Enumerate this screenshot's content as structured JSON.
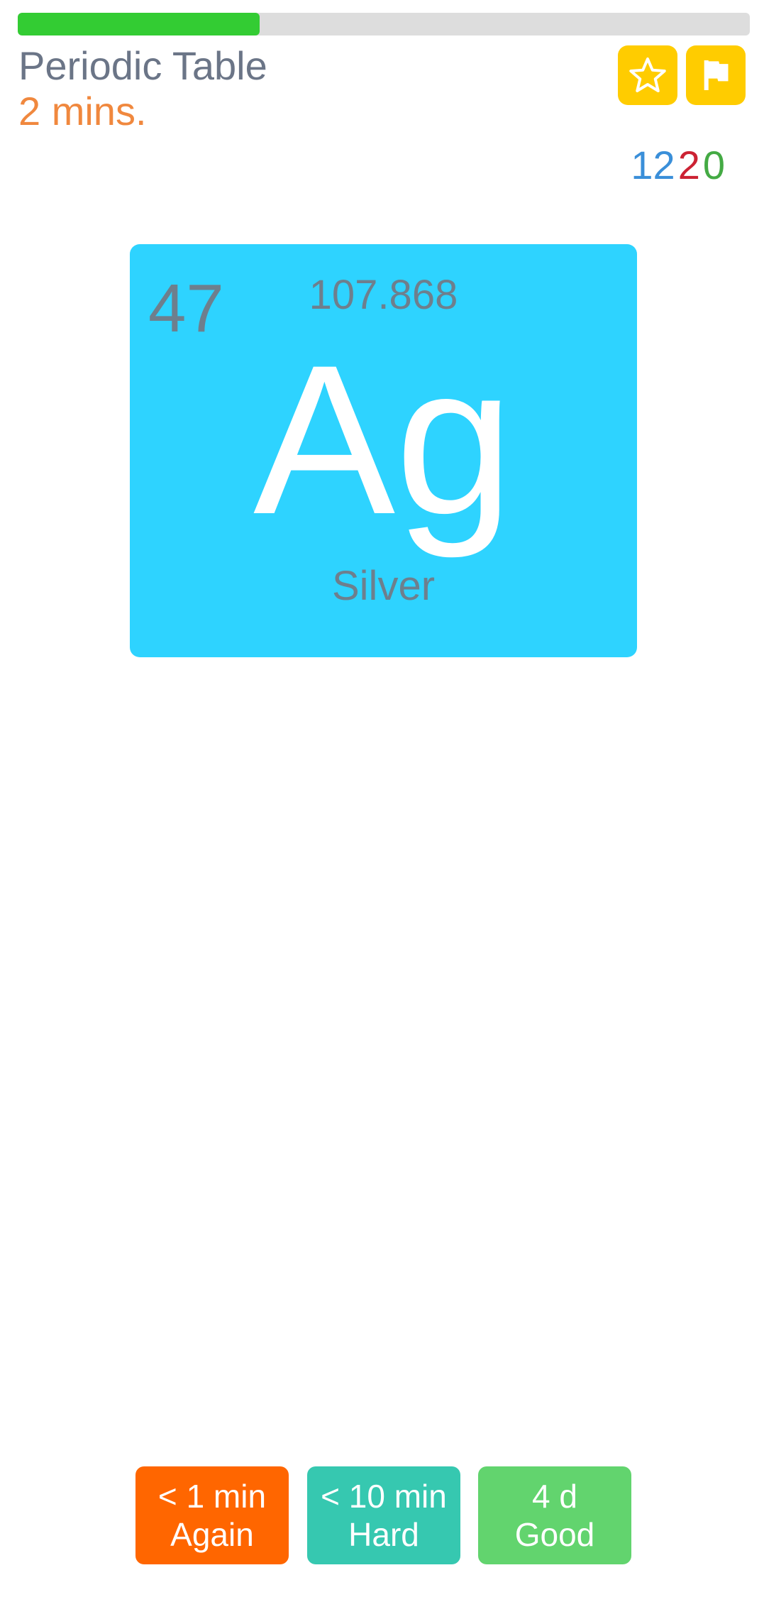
{
  "progress": {
    "fraction": 0.33,
    "fill_color": "#33cc33",
    "track_color": "#dddddd"
  },
  "header": {
    "title": "Periodic Table",
    "time": "2 mins.",
    "star_button_icon": "star-outline-icon",
    "flag_button_icon": "flag-icon"
  },
  "counts": {
    "new": "12",
    "learning": "2",
    "review": "0",
    "colors": {
      "new": "#3a8fd9",
      "learning": "#cc2233",
      "review": "#44aa44"
    }
  },
  "card": {
    "atomic_number": "47",
    "atomic_mass": "107.868",
    "symbol": "Ag",
    "name": "Silver",
    "background": "#2ed3ff"
  },
  "answers": [
    {
      "interval": "< 1 min",
      "label": "Again",
      "color": "#ff6600"
    },
    {
      "interval": "< 10 min",
      "label": "Hard",
      "color": "#36c8b0"
    },
    {
      "interval": "4 d",
      "label": "Good",
      "color": "#62d46e"
    }
  ]
}
